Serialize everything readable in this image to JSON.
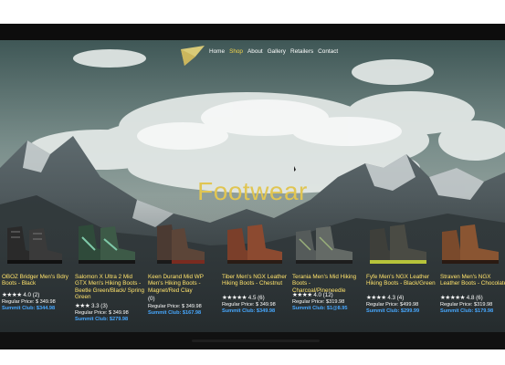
{
  "nav": {
    "items": [
      {
        "label": "Home",
        "active": false
      },
      {
        "label": "Shop",
        "active": true
      },
      {
        "label": "About",
        "active": false
      },
      {
        "label": "Gallery",
        "active": false
      },
      {
        "label": "Retailers",
        "active": false
      },
      {
        "label": "Contact",
        "active": false
      }
    ]
  },
  "page": {
    "title": "Footwear"
  },
  "colors": {
    "accent": "#f4d54a",
    "title": "#e0c552",
    "club": "#47a8ff"
  },
  "products": [
    {
      "name": "OBOZ Bridger Men's Bdry Boots - Black",
      "stars": "★★★★",
      "rating": "4.0 (2)",
      "regular_price": "Regular Price: $ 349.98",
      "club_price": "Summit Club: $344.98"
    },
    {
      "name": "Salomon X Ultra 2 Mid GTX Men's Hiking Boots - Beetle Green/Black/ Spring Green",
      "stars": "★★★",
      "rating": "3.3 (3)",
      "regular_price": "Regular Price: $ 349.98",
      "club_price": "Summit Club: $279.98"
    },
    {
      "name": "Keen Durand Mid WP Men's Hiking Boots - Magnet/Red Clay",
      "stars": "",
      "rating": "(0)",
      "regular_price": "Regular Price: $ 349.98",
      "club_price": "Summit Club: $167.98"
    },
    {
      "name": "Tiber Men's NGX Leather Hiking Boots - Chestnut",
      "stars": "★★★★★",
      "rating": "4.5 (6)",
      "regular_price": "Regular Price: $ 349.98",
      "club_price": "Summit Club: $349.98"
    },
    {
      "name": "Terania Men's Mid Hiking Boots - Charcoal/Pineneedle",
      "stars": "★★★★",
      "rating": "4.0 (12)",
      "regular_price": "Regular Price: $319.98",
      "club_price": "Summit Club: $1@8.95"
    },
    {
      "name": "Fyfe Men's NGX Leather Hiking Boots - Black/Green",
      "stars": "★★★★",
      "rating": "4.3 (4)",
      "regular_price": "Regular Price: $499.98",
      "club_price": "Summit Club: $299.99"
    },
    {
      "name": "Straven Men's NGX Leather Boots - Chocolate",
      "stars": "★★★★★",
      "rating": "4.8 (6)",
      "regular_price": "Regular Price: $319.98",
      "club_price": "Summit Club: $179.98"
    }
  ]
}
